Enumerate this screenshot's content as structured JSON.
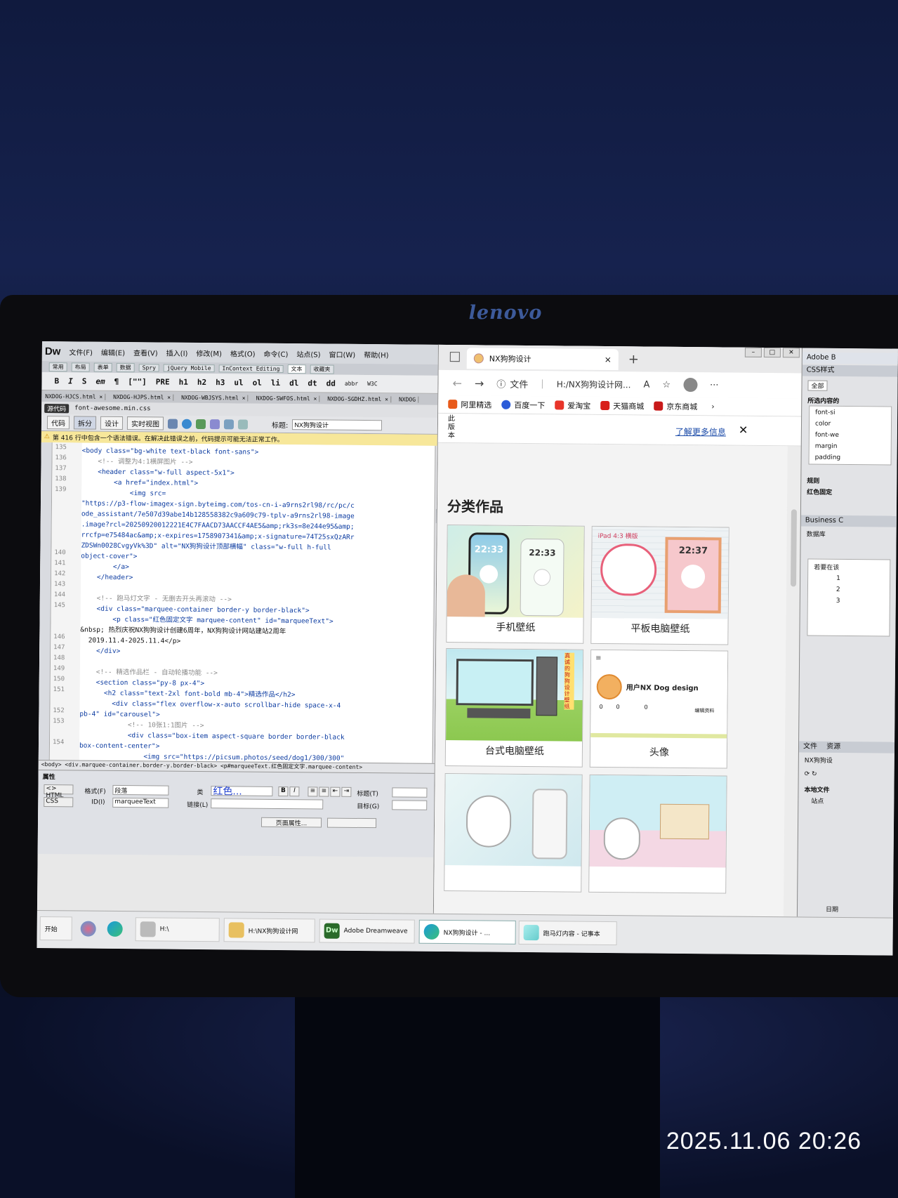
{
  "photo": {
    "timestamp": "2025.11.06 20:26",
    "monitor_brand": "lenovo"
  },
  "dreamweaver": {
    "logo": "Dw",
    "menu": [
      "文件(F)",
      "编辑(E)",
      "查看(V)",
      "插入(I)",
      "修改(M)",
      "格式(O)",
      "命令(C)",
      "站点(S)",
      "窗口(W)",
      "帮助(H)"
    ],
    "insert_tabs": [
      "常用",
      "布局",
      "表单",
      "数据",
      "Spry",
      "jQuery Mobile",
      "InContext Editing",
      "文本",
      "收藏夹"
    ],
    "insert_tab_active": "文本",
    "toolbar": [
      "B",
      "I",
      "S",
      "em",
      "¶",
      "[\"\"]",
      "PRE",
      "h1",
      "h2",
      "h3",
      "ul",
      "ol",
      "li",
      "dl",
      "dt",
      "dd",
      "abbr",
      "W3C"
    ],
    "file_tabs": [
      "NXDOG-HJCS.html ×",
      "NXDOG-HJPS.html ×",
      "NXDOG-WBJSYS.html ×",
      "NXDOG-SWFOS.html ×",
      "NXDOG-SGDHZ.html ×",
      "NXDOG"
    ],
    "related_files": {
      "source": "源代码",
      "file": "font-awesome.min.css"
    },
    "view_buttons": [
      "代码",
      "拆分",
      "设计",
      "实时视图"
    ],
    "title_label": "标题:",
    "title_value": "NX狗狗设计",
    "warning": "第 416 行中包含一个语法错误。在解决此错误之前，代码提示可能无法正常工作。",
    "line_numbers": [
      "135",
      "136",
      "137",
      "138",
      "139",
      "",
      "",
      "",
      "",
      "",
      "140",
      "141",
      "142",
      "143",
      "144",
      "145",
      "",
      "",
      "146",
      "147",
      "148",
      "149",
      "150",
      "151",
      "",
      "152",
      "153",
      "",
      "154"
    ],
    "code_lines": [
      {
        "text": "<body class=\"bg-white text-black font-sans\">",
        "style": "tag"
      },
      {
        "text": "    <!-- 调整为4:1横屏图片 -->",
        "style": "comment"
      },
      {
        "text": "    <header class=\"w-full aspect-5x1\">",
        "style": "tag"
      },
      {
        "text": "        <a href=\"index.html\">",
        "style": "tag"
      },
      {
        "text": "            <img src=",
        "style": "tag"
      },
      {
        "text": "\"https://p3-flow-imagex-sign.byteimg.com/tos-cn-i-a9rns2rl98/rc/pc/c",
        "style": "tag"
      },
      {
        "text": "ode_assistant/7e507d39abe14b128558382c9a609c79-tplv-a9rns2rl98-image",
        "style": "tag"
      },
      {
        "text": ".image?rcl=20250920012221E4C7FAACD73AACCF4AE5&amp;rk3s=8e244e95&amp;",
        "style": "tag"
      },
      {
        "text": "rrcfp=e75484ac&amp;x-expires=1758907341&amp;x-signature=74T25sxQzARr",
        "style": "tag"
      },
      {
        "text": "ZDSWn0028CvgyVk%3D\" alt=\"NX狗狗设计顶部横幅\" class=\"w-full h-full",
        "style": "tag"
      },
      {
        "text": "object-cover\">",
        "style": "tag"
      },
      {
        "text": "        </a>",
        "style": "tag"
      },
      {
        "text": "    </header>",
        "style": "tag"
      },
      {
        "text": "",
        "style": "tag"
      },
      {
        "text": "    <!-- 跑马灯文字 - 无删去开头再滚动 -->",
        "style": "comment"
      },
      {
        "text": "    <div class=\"marquee-container border-y border-black\">",
        "style": "tag"
      },
      {
        "text": "        <p class=\"红色固定文字 marquee-content\" id=\"marqueeText\">",
        "style": "tag"
      },
      {
        "text": "&nbsp; 热烈庆祝NX狗狗设计创建6周年，NX狗狗设计网站建站2周年",
        "style": "text"
      },
      {
        "text": "  2019.11.4-2025.11.4</p>",
        "style": "text"
      },
      {
        "text": "    </div>",
        "style": "tag"
      },
      {
        "text": "",
        "style": "tag"
      },
      {
        "text": "    <!-- 精选作品栏 - 自动轮播功能 -->",
        "style": "comment"
      },
      {
        "text": "    <section class=\"py-8 px-4\">",
        "style": "tag"
      },
      {
        "text": "      <h2 class=\"text-2xl font-bold mb-4\">精选作品</h2>",
        "style": "tag"
      },
      {
        "text": "        <div class=\"flex overflow-x-auto scrollbar-hide space-x-4",
        "style": "tag"
      },
      {
        "text": "pb-4\" id=\"carousel\">",
        "style": "tag"
      },
      {
        "text": "            <!-- 10张1:1图片 -->",
        "style": "comment"
      },
      {
        "text": "            <div class=\"box-item aspect-square border border-black",
        "style": "tag"
      },
      {
        "text": "box-content-center\">",
        "style": "tag"
      },
      {
        "text": "                <img src=\"https://picsum.photos/seed/dog1/300/300\"",
        "style": "tag"
      }
    ],
    "tag_selector": "<body> <div.marquee-container.border-y.border-black> <p#marqueeText.红色固定文字.marquee-content>",
    "properties": {
      "title": "属性",
      "mode_html": "<> HTML",
      "mode_css": "CSS",
      "format_label": "格式(F)",
      "format_value": "段落",
      "id_label": "ID(I)",
      "id_value": "marqueeText",
      "class_label": "类",
      "class_value": "红色...",
      "link_label": "链接(L)",
      "target_label": "目标(G)",
      "title_attr_label": "标题(T)",
      "page_props_button": "页面属性..."
    }
  },
  "browser": {
    "tab_title": "NX狗狗设计",
    "tab_close": "×",
    "new_tab": "+",
    "address_prefix": "文件",
    "address_url": "H:/NX狗狗设计网...",
    "favorites": [
      "阿里精选",
      "百度一下",
      "爱淘宝",
      "天猫商城",
      "京东商城"
    ],
    "info_side": "此版本",
    "info_link": "了解更多信息",
    "section_title": "分类作品",
    "cards": [
      {
        "label": "手机壁纸",
        "time": "22:33",
        "time2": "22:33"
      },
      {
        "label": "平板电脑壁纸",
        "time": "22:37",
        "banner": "iPad 4:3 横版"
      },
      {
        "label": "台式电脑壁纸",
        "banner": "真诚的狗狗设计壁纸"
      },
      {
        "label": "头像",
        "profile_name": "用户NX Dog design",
        "profile_stats": [
          "0",
          "0",
          "0"
        ],
        "profile_btn": "编辑资料"
      },
      {
        "label": ""
      },
      {
        "label": ""
      }
    ]
  },
  "right_panel": {
    "app_title": "Adobe B",
    "css_styles": "CSS样式",
    "all_tab": "全部",
    "selected_label": "所选内容的",
    "properties": [
      "font-si",
      "color",
      "font-we",
      "margin",
      "padding"
    ],
    "rules_label": "规则",
    "rule_item": "红色固定",
    "business": "Business C",
    "database": "数据库",
    "steps_label": "若要在该",
    "steps": [
      "1",
      "2",
      "3"
    ],
    "files_tab": "文件",
    "assets_tab": "资源",
    "site_name": "NX狗狗设",
    "local_files": "本地文件",
    "site_root": "站点",
    "date_label": "日期"
  },
  "taskbar": {
    "start": "开始",
    "items": [
      "H:\\",
      "H:\\NX狗狗设计网",
      "Adobe Dreamweave",
      "NX狗狗设计 - ...",
      "跑马灯内容 - 记事本"
    ]
  }
}
